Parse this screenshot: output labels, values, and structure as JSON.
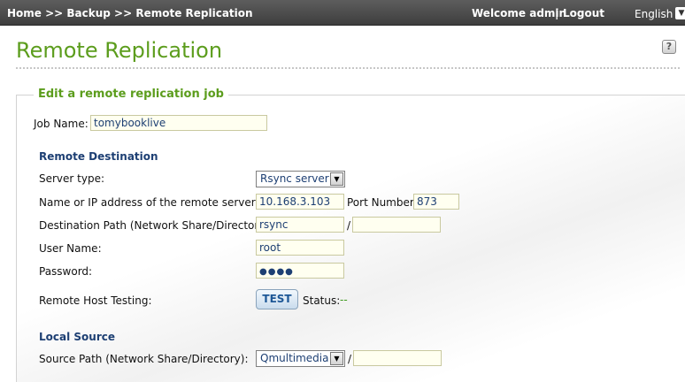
{
  "topbar": {
    "breadcrumb": "Home >> Backup >> Remote Replication",
    "welcome": "Welcome admin",
    "separator": "|",
    "logout": "Logout",
    "language": "English"
  },
  "page": {
    "title": "Remote Replication",
    "help": "?"
  },
  "form": {
    "legend": "Edit a remote replication job",
    "job_name_label": "Job Name:",
    "job_name_value": "tomybooklive",
    "remote_section": "Remote Destination",
    "server_type_label": "Server type:",
    "server_type_value": "Rsync server",
    "remote_server_label": "Name or IP address of the remote server:",
    "remote_server_value": "10.168.3.103",
    "port_label": "Port Number:",
    "port_value": "873",
    "dest_path_label": "Destination Path (Network Share/Directory):",
    "dest_share_value": "rsync",
    "path_sep": "/",
    "dest_dir_value": "",
    "user_label": "User Name:",
    "user_value": "root",
    "password_label": "Password:",
    "password_value": "●●●●",
    "host_test_label": "Remote Host Testing:",
    "test_button": "TEST",
    "status_label": "Status:",
    "status_value": "--",
    "local_section": "Local Source",
    "source_path_label": "Source Path (Network Share/Directory):",
    "source_share_value": "Qmultimedia",
    "source_dir_value": ""
  }
}
